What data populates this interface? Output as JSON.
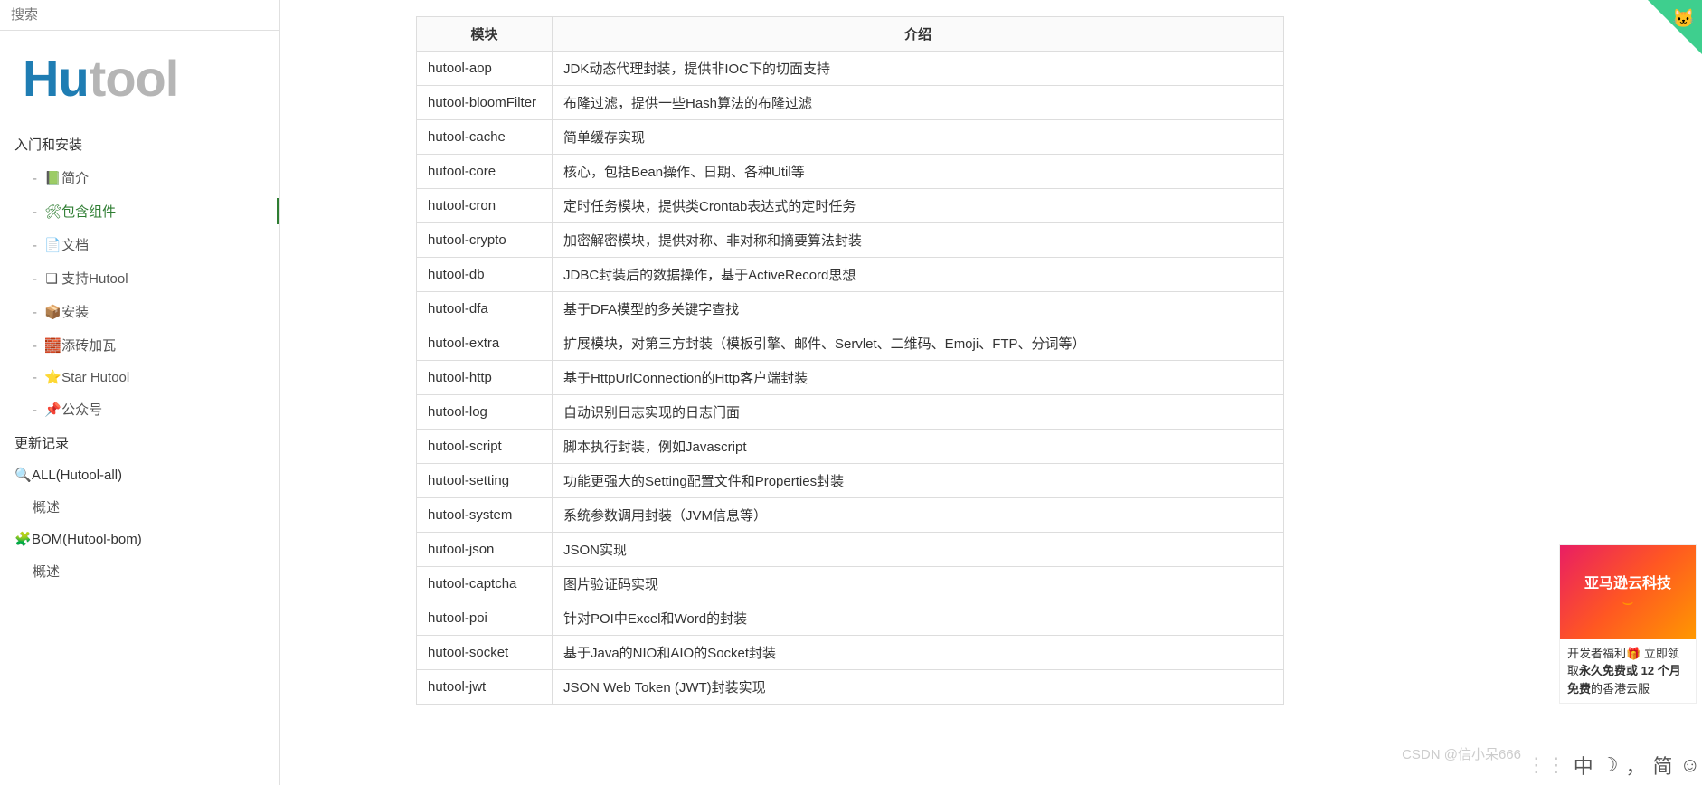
{
  "search": {
    "placeholder": "搜索"
  },
  "logo": {
    "h": "H",
    "u": "u",
    "rest": "tool"
  },
  "nav": {
    "section1": "入门和安装",
    "items1": [
      {
        "dash": "- ",
        "icon": "📗",
        "label": "简介"
      },
      {
        "dash": "- ",
        "icon": "🛠",
        "label": "包含组件",
        "active": true
      },
      {
        "dash": "- ",
        "icon": "📄",
        "label": "文档"
      },
      {
        "dash": "- ",
        "icon": "❑",
        "label": "支持Hutool"
      },
      {
        "dash": "- ",
        "icon": "📦",
        "label": "安装"
      },
      {
        "dash": "- ",
        "icon": "🧱",
        "label": "添砖加瓦"
      },
      {
        "dash": "- ",
        "icon": "⭐",
        "label": "Star Hutool"
      },
      {
        "dash": "- ",
        "icon": "📌",
        "label": "公众号"
      }
    ],
    "section2": "更新记录",
    "section3_icon": "🔍",
    "section3": "ALL(Hutool-all)",
    "items3": [
      {
        "label": "概述"
      }
    ],
    "section4_icon": "🧩",
    "section4": "BOM(Hutool-bom)",
    "items4": [
      {
        "label": "概述"
      }
    ]
  },
  "table": {
    "headers": {
      "module": "模块",
      "desc": "介绍"
    },
    "rows": [
      {
        "module": "hutool-aop",
        "desc": "JDK动态代理封装，提供非IOC下的切面支持"
      },
      {
        "module": "hutool-bloomFilter",
        "desc": "布隆过滤，提供一些Hash算法的布隆过滤"
      },
      {
        "module": "hutool-cache",
        "desc": "简单缓存实现"
      },
      {
        "module": "hutool-core",
        "desc": "核心，包括Bean操作、日期、各种Util等"
      },
      {
        "module": "hutool-cron",
        "desc": "定时任务模块，提供类Crontab表达式的定时任务"
      },
      {
        "module": "hutool-crypto",
        "desc": "加密解密模块，提供对称、非对称和摘要算法封装"
      },
      {
        "module": "hutool-db",
        "desc": "JDBC封装后的数据操作，基于ActiveRecord思想"
      },
      {
        "module": "hutool-dfa",
        "desc": "基于DFA模型的多关键字查找"
      },
      {
        "module": "hutool-extra",
        "desc": "扩展模块，对第三方封装（模板引擎、邮件、Servlet、二维码、Emoji、FTP、分词等）"
      },
      {
        "module": "hutool-http",
        "desc": "基于HttpUrlConnection的Http客户端封装"
      },
      {
        "module": "hutool-log",
        "desc": "自动识别日志实现的日志门面"
      },
      {
        "module": "hutool-script",
        "desc": "脚本执行封装，例如Javascript"
      },
      {
        "module": "hutool-setting",
        "desc": "功能更强大的Setting配置文件和Properties封装"
      },
      {
        "module": "hutool-system",
        "desc": "系统参数调用封装（JVM信息等）"
      },
      {
        "module": "hutool-json",
        "desc": "JSON实现"
      },
      {
        "module": "hutool-captcha",
        "desc": "图片验证码实现"
      },
      {
        "module": "hutool-poi",
        "desc": "针对POI中Excel和Word的封装"
      },
      {
        "module": "hutool-socket",
        "desc": "基于Java的NIO和AIO的Socket封装"
      },
      {
        "module": "hutool-jwt",
        "desc": "JSON Web Token (JWT)封装实现"
      }
    ]
  },
  "ad": {
    "img_text": "亚马逊云科技",
    "line1a": "开发者福利",
    "gift": "🎁",
    "line1b": " 立即领取",
    "bold1": "永久免费或 12 个月免费",
    "line2": "的香港云服"
  },
  "watermark": "CSDN @信小呆666",
  "ime": {
    "zh": "中",
    "moon": "☽",
    "comma": "，",
    "jian": "简",
    "smile": "☺"
  }
}
